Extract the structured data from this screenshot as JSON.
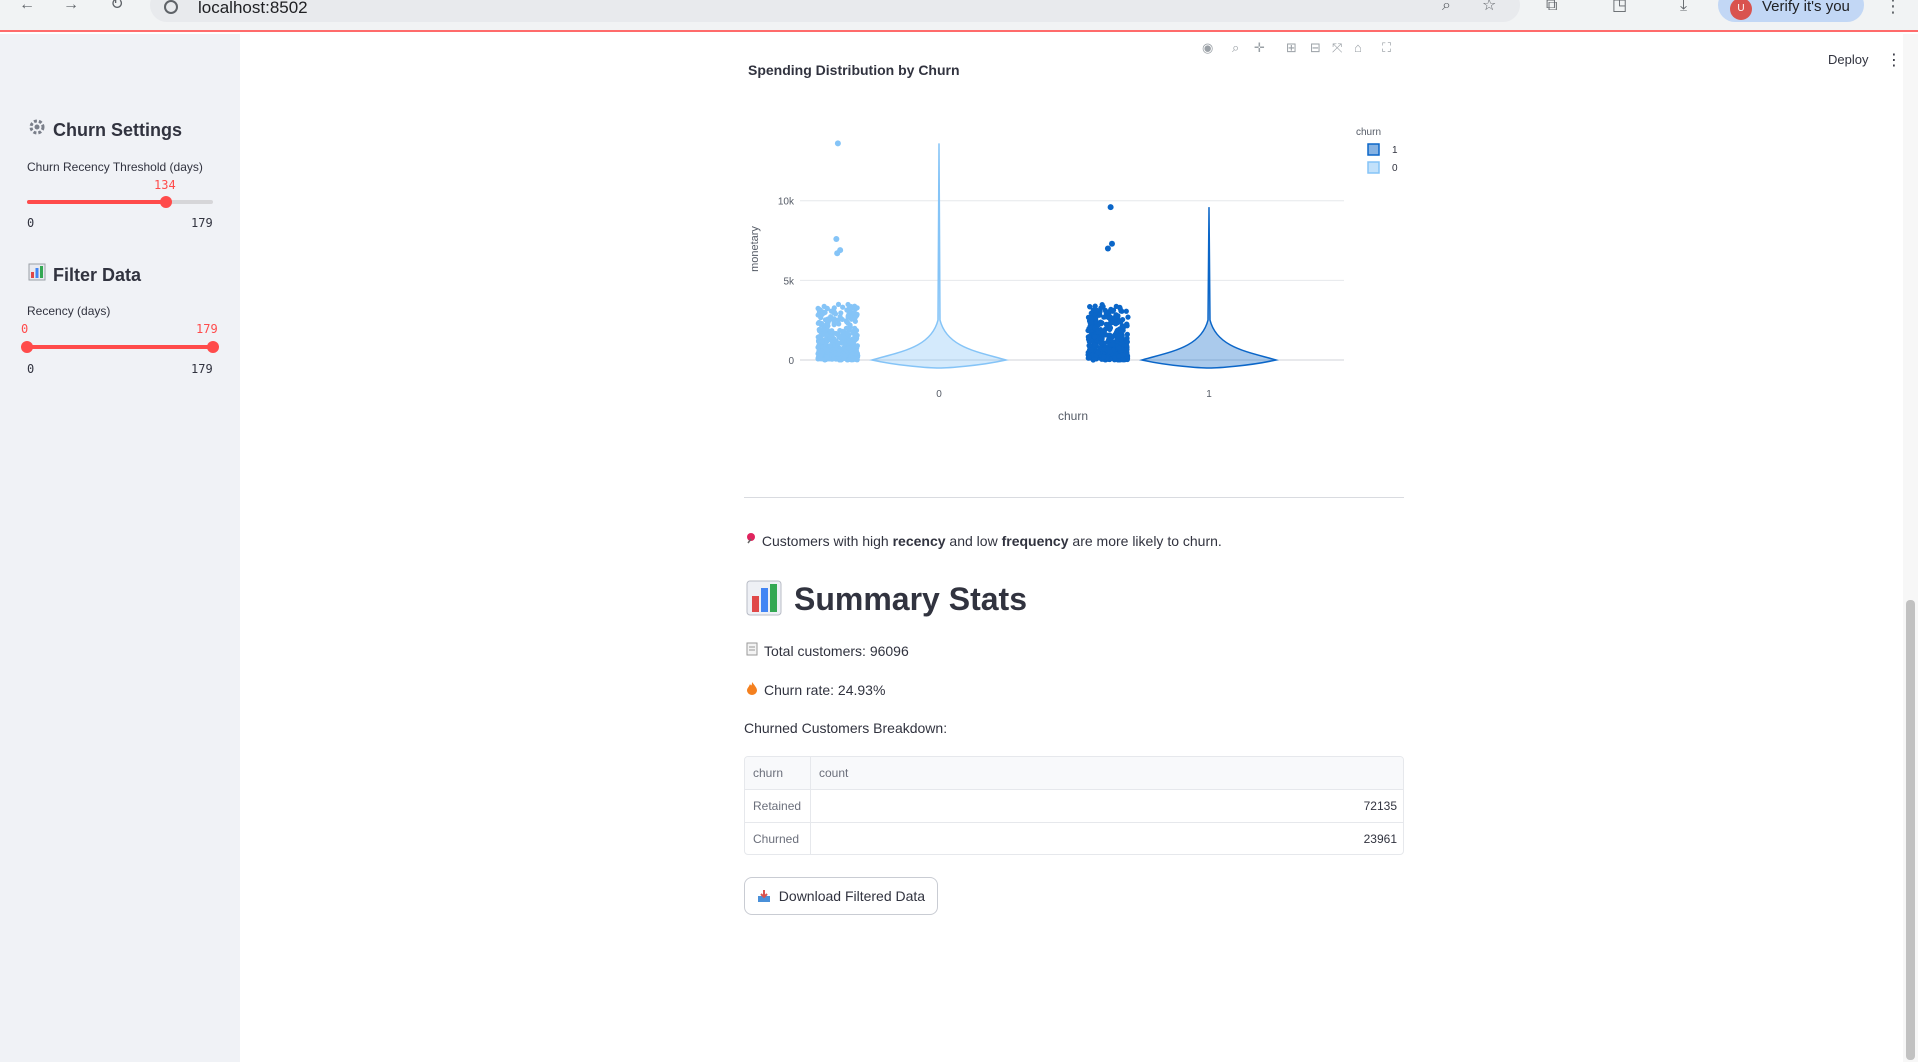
{
  "browser": {
    "url": "localhost:8502",
    "profile_text": "Verify it's you",
    "profile_initial": "U"
  },
  "header": {
    "deploy_label": "Deploy",
    "menu_icon": "kebab-icon"
  },
  "sidebar": {
    "churn_settings": {
      "heading": "Churn Settings",
      "icon": "gear-icon",
      "slider_label": "Churn Recency Threshold (days)",
      "value": "134",
      "min": "0",
      "max": "179",
      "fraction": 0.7486
    },
    "filter_data": {
      "heading": "Filter Data",
      "icon": "bar-chart-icon",
      "slider_label": "Recency (days)",
      "low": "0",
      "high": "179",
      "min": "0",
      "max": "179"
    }
  },
  "chart_data": {
    "type": "violin",
    "title": "Spending Distribution by Churn",
    "xlabel": "churn",
    "ylabel": "monetary",
    "categories": [
      "0",
      "1"
    ],
    "yticks": [
      0,
      5000,
      10000
    ],
    "ytick_labels": [
      "0",
      "5k",
      "10k"
    ],
    "ylim": [
      0,
      14000
    ],
    "legend": {
      "title": "churn",
      "entries": [
        "1",
        "0"
      ],
      "placement": "top-right"
    },
    "series": [
      {
        "name": "0",
        "color": "#85c4f7",
        "max": 13600,
        "outliers": [
          13600,
          7600,
          6900,
          6700
        ]
      },
      {
        "name": "1",
        "color": "#0b66c8",
        "max": 9600,
        "outliers": [
          9600,
          7300,
          7000
        ]
      }
    ]
  },
  "content": {
    "note_prefix": "Customers with high ",
    "note_b1": "recency",
    "note_mid": " and low ",
    "note_b2": "frequency",
    "note_suffix": " are more likely to churn.",
    "summary_heading": "Summary Stats",
    "total_customers": "Total customers: 96096",
    "churn_rate": "Churn rate: 24.93%",
    "breakdown_label": "Churned Customers Breakdown:",
    "table": {
      "columns": [
        "churn",
        "count"
      ],
      "rows": [
        {
          "churn": "Retained",
          "count": "72135"
        },
        {
          "churn": "Churned",
          "count": "23961"
        }
      ]
    },
    "download_label": "Download Filtered Data"
  },
  "colors": {
    "accent": "#ff4b4b",
    "sidebar_bg": "#f0f2f6"
  }
}
